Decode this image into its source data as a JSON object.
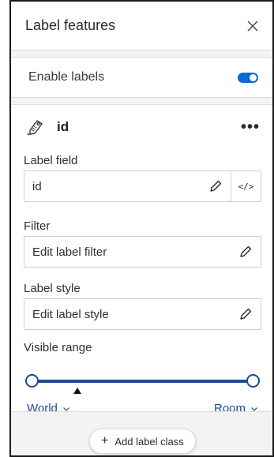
{
  "panel": {
    "title": "Label features",
    "close_icon": "close-icon"
  },
  "enable": {
    "label": "Enable labels",
    "enabled": true
  },
  "label_class": {
    "icon": "tag-icon",
    "name": "id",
    "menu": "•••",
    "label_field": {
      "label": "Label field",
      "value": "id",
      "code_label": "</>"
    },
    "filter": {
      "label": "Filter",
      "value": "Edit label filter"
    },
    "style": {
      "label": "Label style",
      "value": "Edit label style"
    },
    "visible_range": {
      "label": "Visible range",
      "min": "World",
      "max": "Room"
    }
  },
  "footer": {
    "add_plus": "+",
    "add_label": "Add label class"
  },
  "colors": {
    "accent": "#0a6bd6",
    "slider": "#1d4b8f"
  }
}
